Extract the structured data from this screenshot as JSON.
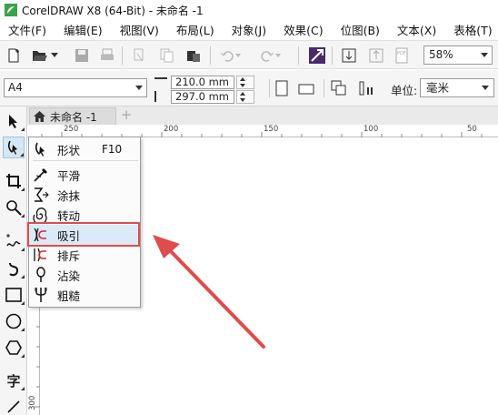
{
  "window": {
    "title": "CorelDRAW X8 (64-Bit) - 未命名 -1"
  },
  "menu": {
    "items": [
      "文件(F)",
      "编辑(E)",
      "视图(V)",
      "布局(L)",
      "对象(J)",
      "效果(C)",
      "位图(B)",
      "文本(X)",
      "表格(T)"
    ]
  },
  "toolbar": {
    "zoom_value": "58%",
    "icons": [
      "new-document-icon",
      "open-icon",
      "save-icon",
      "print-icon",
      "cut-icon",
      "copy-icon",
      "paste-icon",
      "undo-icon",
      "redo-icon",
      "import-export-icon",
      "import-icon",
      "export-icon",
      "pdf-icon"
    ]
  },
  "property_bar": {
    "page_size": "A4",
    "width": "210.0 mm",
    "height": "297.0 mm",
    "unit_label": "单位:",
    "unit_value": "毫米"
  },
  "document": {
    "tab_label": "未命名 -1",
    "add_tab": "+"
  },
  "rulers": {
    "horizontal": [
      "250",
      "200",
      "150",
      "100",
      "50"
    ],
    "vertical": [
      "300"
    ]
  },
  "flyout": {
    "items": [
      {
        "label": "形状",
        "shortcut": "F10",
        "icon": "shape-tool-icon"
      },
      {
        "label": "平滑",
        "icon": "smooth-tool-icon"
      },
      {
        "label": "涂抹",
        "icon": "smear-tool-icon"
      },
      {
        "label": "转动",
        "icon": "twirl-tool-icon"
      },
      {
        "label": "吸引",
        "icon": "attract-tool-icon"
      },
      {
        "label": "排斥",
        "icon": "repel-tool-icon"
      },
      {
        "label": "沾染",
        "icon": "smudge-tool-icon"
      },
      {
        "label": "粗糙",
        "icon": "roughen-tool-icon"
      }
    ],
    "highlighted": "吸引"
  },
  "toolbox": {
    "text_tool_glyph": "字"
  },
  "colors": {
    "highlight_border": "#e04b4b",
    "arrow": "#e04b4b",
    "selection_bg": "#dbeaf7",
    "logo_green": "#3aa24a"
  }
}
